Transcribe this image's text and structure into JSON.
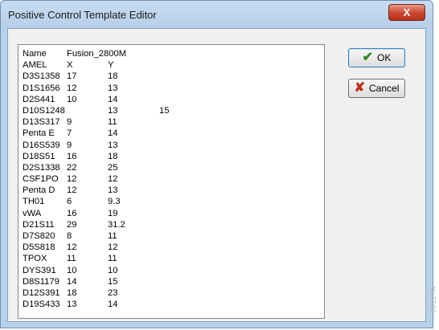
{
  "window": {
    "title": "Positive Control Template Editor",
    "close_glyph": "X"
  },
  "buttons": {
    "ok_label": "OK",
    "cancel_label": "Cancel",
    "ok_icon": "checkmark-icon",
    "cancel_icon": "x-icon"
  },
  "template": {
    "name_label": "Name",
    "name_value": "Fusion_2800M",
    "rows": [
      {
        "locus": "AMEL",
        "a1": "X",
        "a2": "Y",
        "a3": ""
      },
      {
        "locus": "D3S1358",
        "a1": "17",
        "a2": "18",
        "a3": ""
      },
      {
        "locus": "D1S1656",
        "a1": "12",
        "a2": "13",
        "a3": ""
      },
      {
        "locus": "D2S441",
        "a1": "10",
        "a2": "14",
        "a3": ""
      },
      {
        "locus": "D10S1248",
        "a1": "",
        "a2": "13",
        "a3": "15"
      },
      {
        "locus": "D13S317",
        "a1": "9",
        "a2": "11",
        "a3": ""
      },
      {
        "locus": "Penta E",
        "a1": "7",
        "a2": "14",
        "a3": ""
      },
      {
        "locus": "D16S539",
        "a1": "9",
        "a2": "13",
        "a3": ""
      },
      {
        "locus": "D18S51",
        "a1": "16",
        "a2": "18",
        "a3": ""
      },
      {
        "locus": "D2S1338",
        "a1": "22",
        "a2": "25",
        "a3": ""
      },
      {
        "locus": "CSF1PO",
        "a1": "12",
        "a2": "12",
        "a3": ""
      },
      {
        "locus": "Penta D",
        "a1": "12",
        "a2": "13",
        "a3": ""
      },
      {
        "locus": "TH01",
        "a1": "6",
        "a2": "9.3",
        "a3": ""
      },
      {
        "locus": "vWA",
        "a1": "16",
        "a2": "19",
        "a3": ""
      },
      {
        "locus": "D21S11",
        "a1": "29",
        "a2": "31.2",
        "a3": ""
      },
      {
        "locus": "D7S820",
        "a1": "8",
        "a2": "11",
        "a3": ""
      },
      {
        "locus": "D5S818",
        "a1": "12",
        "a2": "12",
        "a3": ""
      },
      {
        "locus": "TPOX",
        "a1": "11",
        "a2": "11",
        "a3": ""
      },
      {
        "locus": "DYS391",
        "a1": "10",
        "a2": "10",
        "a3": ""
      },
      {
        "locus": "D8S1179",
        "a1": "14",
        "a2": "15",
        "a3": ""
      },
      {
        "locus": "D12S391",
        "a1": "18",
        "a2": "23",
        "a3": ""
      },
      {
        "locus": "D19S433",
        "a1": "13",
        "a2": "14",
        "a3": ""
      }
    ]
  },
  "watermark": "6812TA"
}
